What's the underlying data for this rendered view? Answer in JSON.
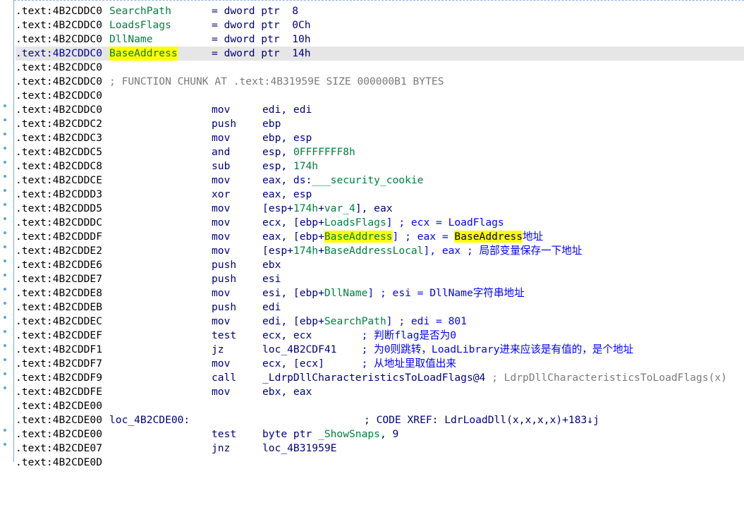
{
  "listing": {
    "rows": [
      {
        "addr": ".text:4B2CDDC0",
        "label": "SearchPath",
        "eq": "= dword ptr  8"
      },
      {
        "addr": ".text:4B2CDDC0",
        "label": "LoadsFlags",
        "eq": "= dword ptr  0Ch"
      },
      {
        "addr": ".text:4B2CDDC0",
        "label": "DllName",
        "eq": "= dword ptr  10h"
      },
      {
        "addr": ".text:4B2CDDC0",
        "label": "BaseAddress",
        "eq": "= dword ptr  14h",
        "highlight": true
      },
      {
        "addr": ".text:4B2CDDC0"
      },
      {
        "addr": ".text:4B2CDDC0",
        "text": "; FUNCTION CHUNK AT .text:4B31959E SIZE 000000B1 BYTES"
      },
      {
        "addr": ".text:4B2CDDC0"
      },
      {
        "addr": ".text:4B2CDDC0",
        "mn": "mov",
        "op": "edi, edi"
      },
      {
        "addr": ".text:4B2CDDC2",
        "mn": "push",
        "op": "ebp"
      },
      {
        "addr": ".text:4B2CDDC3",
        "mn": "mov",
        "op": "ebp, esp"
      },
      {
        "addr": ".text:4B2CDDC5",
        "mn": "and",
        "op1": "esp, ",
        "op2": "0FFFFFFF8h"
      },
      {
        "addr": ".text:4B2CDDC8",
        "mn": "sub",
        "op1": "esp, ",
        "op2": "174h"
      },
      {
        "addr": ".text:4B2CDDCE",
        "mn": "mov",
        "op1": "eax, ds:",
        "op2": "___security_cookie"
      },
      {
        "addr": ".text:4B2CDDD3",
        "mn": "xor",
        "op": "eax, esp"
      },
      {
        "addr": ".text:4B2CDDD5",
        "mn": "mov",
        "op1": "[esp+",
        "op2": "174h",
        "op3": "+",
        "op4": "var_4",
        "op5": "], eax"
      },
      {
        "addr": ".text:4B2CDDDC",
        "mn": "mov",
        "op1": "ecx, [ebp+",
        "op2": "LoadsFlags",
        "op3": "] ; ecx = LoadFlags"
      },
      {
        "addr": ".text:4B2CDDDF",
        "mn": "mov",
        "op1": "eax, [ebp+",
        "op2": "BaseAddress",
        "op3": "] ; eax = ",
        "op4": "BaseAddress",
        "op5": "地址"
      },
      {
        "addr": ".text:4B2CDDE2",
        "mn": "mov",
        "op1": "[esp+",
        "op2": "174h",
        "op3": "+",
        "op4": "BaseAddressLocal",
        "op5": "], eax ; 局部变量保存一下地址"
      },
      {
        "addr": ".text:4B2CDDE6",
        "mn": "push",
        "op": "ebx"
      },
      {
        "addr": ".text:4B2CDDE7",
        "mn": "push",
        "op": "esi"
      },
      {
        "addr": ".text:4B2CDDE8",
        "mn": "mov",
        "op1": "esi, [ebp+",
        "op2": "DllName",
        "op3": "] ; esi = DllName字符串地址"
      },
      {
        "addr": ".text:4B2CDDEB",
        "mn": "push",
        "op": "edi"
      },
      {
        "addr": ".text:4B2CDDEC",
        "mn": "mov",
        "op1": "edi, [ebp+",
        "op2": "SearchPath",
        "op3": "] ; edi = 801"
      },
      {
        "addr": ".text:4B2CDDEF",
        "mn": "test",
        "op1": "ecx, ecx",
        "op2": "        ; 判断flag是否为0"
      },
      {
        "addr": ".text:4B2CDDF1",
        "mn": "jz",
        "op1": "loc_4B2CDF41",
        "op2": "    ; 为0则跳转，LoadLibrary进来应该是有值的，是个地址"
      },
      {
        "addr": ".text:4B2CDDF7",
        "mn": "mov",
        "op1": "ecx, [ecx]",
        "op2": "      ; 从地址里取值出来"
      },
      {
        "addr": ".text:4B2CDDF9",
        "mn": "call",
        "op1": "_LdrpDllCharacteristicsToLoadFlags@4",
        "op2": " ; LdrpDllCharacteristicsToLoadFlags(x)"
      },
      {
        "addr": ".text:4B2CDDFE",
        "mn": "mov",
        "op": "ebx, eax"
      },
      {
        "addr": ".text:4B2CDE00"
      },
      {
        "addr": ".text:4B2CDE00",
        "loc": "loc_4B2CDE00:",
        "xref": "; CODE XREF: LdrLoadDll(x,x,x,x)+183↓j"
      },
      {
        "addr": ".text:4B2CDE00",
        "mn": "test",
        "op1": "byte ptr ",
        "op2": "_ShowSnaps",
        "op3": ", 9"
      },
      {
        "addr": ".text:4B2CDE07",
        "mn": "jnz",
        "op": "loc_4B31959E"
      },
      {
        "addr": ".text:4B2CDE0D"
      }
    ]
  },
  "colors": {
    "background": "#ffffff",
    "highlight_row": "#e6e6e6",
    "selection": "#ffff00",
    "mnemonic": "#000080",
    "name": "#008040",
    "comment_gray": "#7a7a7a",
    "comment_blue": "#0000ff",
    "gutter_dot": "#5aa6d8"
  }
}
